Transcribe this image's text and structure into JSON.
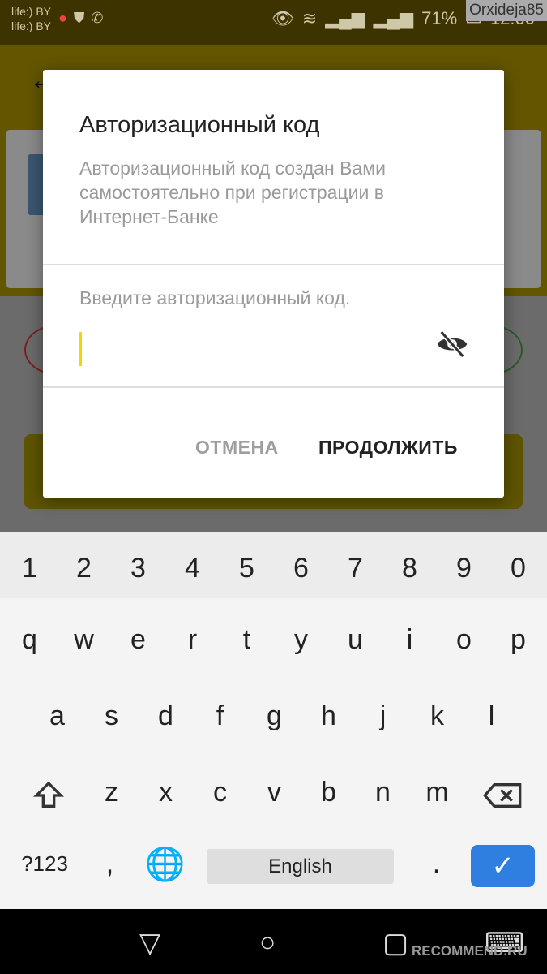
{
  "status_bar": {
    "carrier1": "life:) BY",
    "carrier2": "life:) BY",
    "battery": "71%",
    "time": "12:00",
    "watermark": "Orxideja85"
  },
  "dialog": {
    "title": "Авторизационный код",
    "description": "Авторизационный код создан Вами самостоятельно при регистрации в Интернет-Банке",
    "input_label": "Введите авторизационный код.",
    "input_value": "",
    "cancel": "ОТМЕНА",
    "continue": "ПРОДОЛЖИТЬ"
  },
  "keyboard": {
    "numbers": [
      "1",
      "2",
      "3",
      "4",
      "5",
      "6",
      "7",
      "8",
      "9",
      "0"
    ],
    "row1": [
      "q",
      "w",
      "e",
      "r",
      "t",
      "y",
      "u",
      "i",
      "o",
      "p"
    ],
    "row2": [
      "a",
      "s",
      "d",
      "f",
      "g",
      "h",
      "j",
      "k",
      "l"
    ],
    "row3": [
      "z",
      "x",
      "c",
      "v",
      "b",
      "n",
      "m"
    ],
    "symbols": "?123",
    "comma": ",",
    "space": "English",
    "period": ".",
    "enter_color": "#2f7fe0"
  },
  "footer_watermark": "RECOMMEND.RU"
}
